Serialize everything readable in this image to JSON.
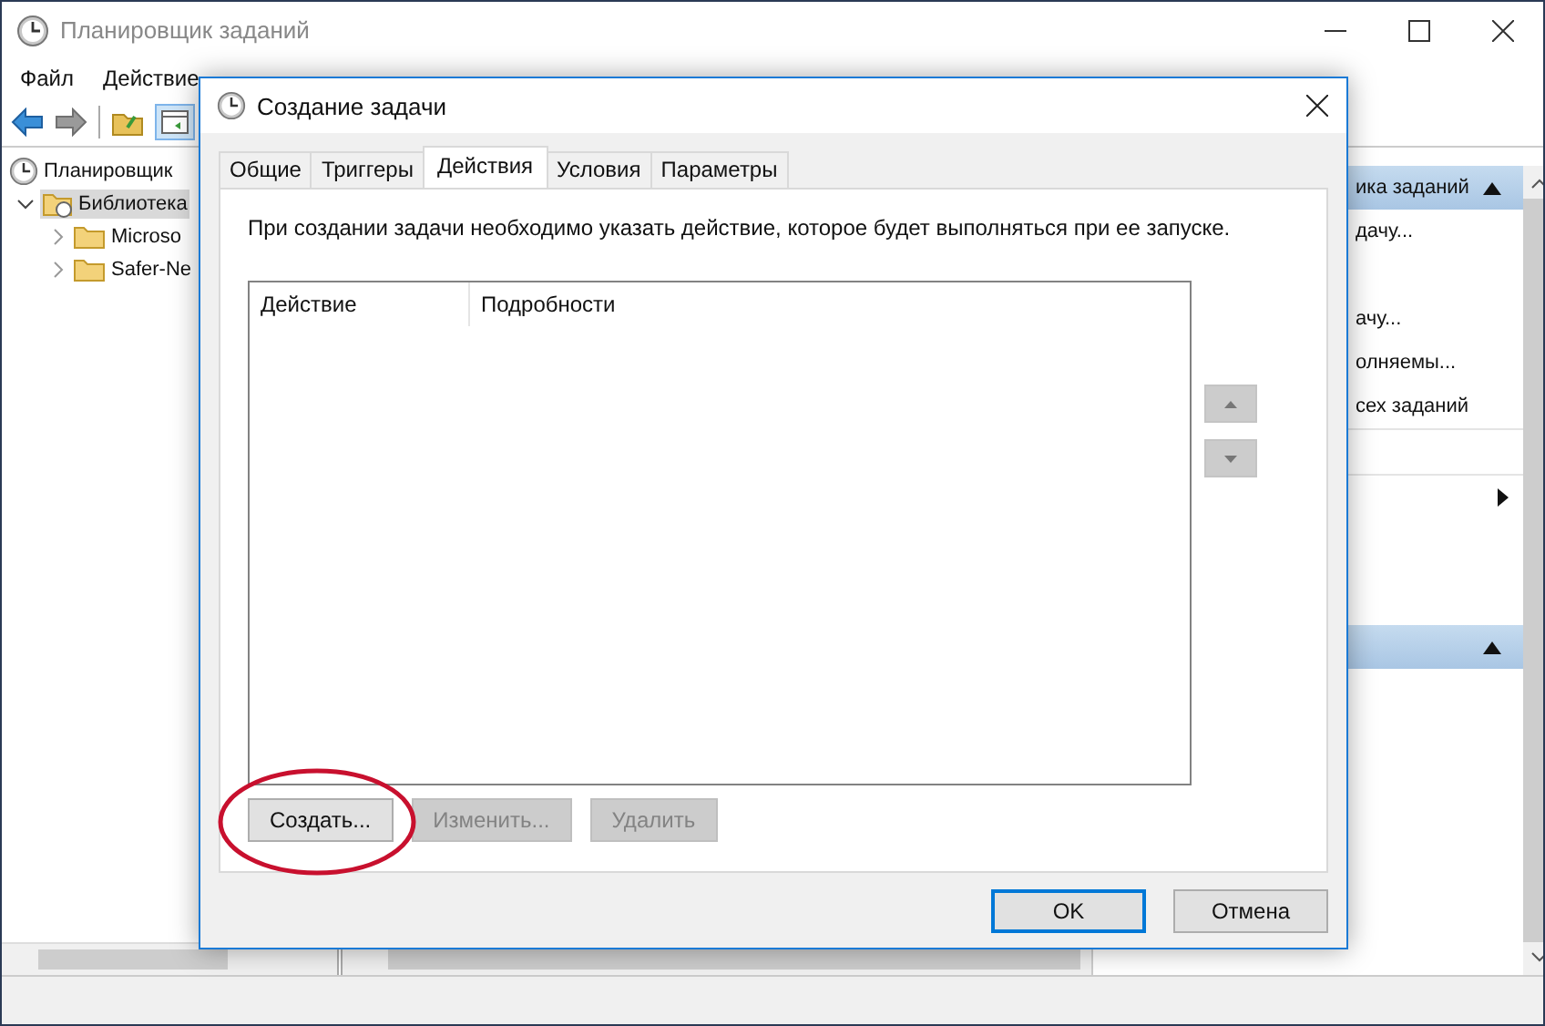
{
  "main_window": {
    "title": "Планировщик заданий",
    "menu": [
      "Файл",
      "Действие"
    ],
    "tree": [
      {
        "label": "Планировщик",
        "selected": false,
        "children": [
          {
            "label": "Библиотека",
            "expanded": true,
            "selected": true,
            "children": [
              {
                "label": "Microso",
                "expanded": false,
                "selected": false
              },
              {
                "label": "Safer-Ne",
                "expanded": false,
                "selected": false
              }
            ]
          }
        ]
      }
    ],
    "actions_panel": {
      "sections": [
        {
          "header": "ика заданий",
          "expanded": true,
          "items": [
            {
              "kind": "command",
              "label": "дачу..."
            },
            {
              "kind": "command",
              "label": "ачу..."
            },
            {
              "kind": "command",
              "label": "олняемы..."
            },
            {
              "kind": "command",
              "label": "сех заданий"
            },
            {
              "kind": "submenu"
            }
          ]
        },
        {
          "expanded": true
        }
      ]
    }
  },
  "dialog": {
    "title": "Создание задачи",
    "tabs": [
      {
        "label": "Общие",
        "selected": false
      },
      {
        "label": "Триггеры",
        "selected": false
      },
      {
        "label": "Действия",
        "selected": true
      },
      {
        "label": "Условия",
        "selected": false
      },
      {
        "label": "Параметры",
        "selected": false
      }
    ],
    "hint": "При создании задачи необходимо указать действие, которое будет выполняться при ее запуске.",
    "table": {
      "columns": [
        "Действие",
        "Подробности"
      ]
    },
    "row_buttons": [
      {
        "label": "Создать...",
        "disabled": false,
        "highlighted": true
      },
      {
        "label": "Изменить...",
        "disabled": true,
        "highlighted": false
      },
      {
        "label": "Удалить",
        "disabled": true,
        "highlighted": false
      }
    ],
    "footer_buttons": [
      {
        "label": "OK",
        "default": true
      },
      {
        "label": "Отмена",
        "default": false
      }
    ]
  }
}
